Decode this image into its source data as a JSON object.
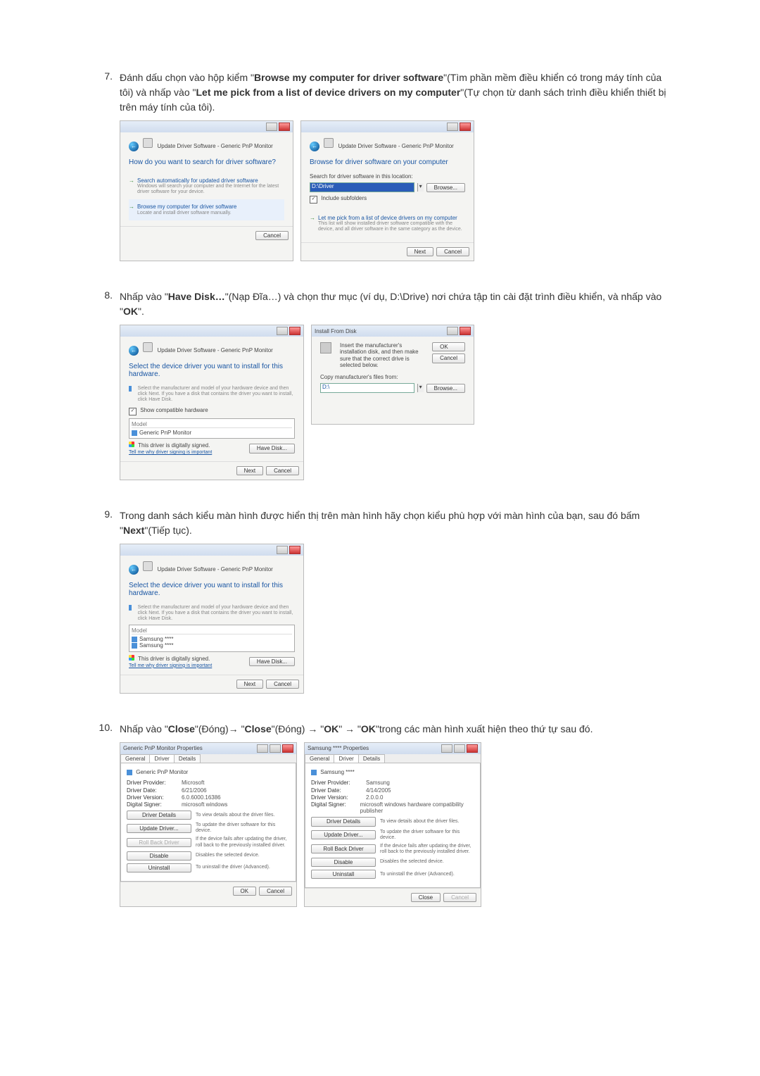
{
  "steps": {
    "s7": {
      "num": "7.",
      "text_pre": "Đánh dấu chọn vào hộp kiểm \"",
      "b1": "Browse my computer for driver software",
      "text_mid1": "\"(Tìm phần mềm điều khiển có trong máy tính của tôi) và nhấp vào \"",
      "b2": "Let me pick from a list of device drivers on my computer",
      "text_mid2": "\"(Tự chọn từ danh sách trình điều khiển thiết bị trên máy tính của tôi)."
    },
    "s8": {
      "num": "8.",
      "text_pre": "Nhấp vào \"",
      "b1": "Have Disk…",
      "text_mid1": "\"(Nạp Đĩa…) và chọn thư mục (ví dụ, D:\\Drive) nơi chứa tập tin cài đặt trình điều khiển, và nhấp vào \"",
      "b2": "OK",
      "text_end": "\"."
    },
    "s9": {
      "num": "9.",
      "text_pre": "Trong danh sách kiểu màn hình được hiển thị trên màn hình hãy chọn kiểu phù hợp với màn hình của bạn, sau đó bấm \"",
      "b1": "Next",
      "text_end": "\"(Tiếp tục)."
    },
    "s10": {
      "num": "10.",
      "text_pre": "Nhấp vào \"",
      "b1": "Close",
      "text_m1": "\"(Đóng)→ \"",
      "b2": "Close",
      "text_m2": "\"(Đóng) → \"",
      "b3": "OK",
      "text_m3": "\" → \"",
      "b4": "OK",
      "text_end": "\"trong các màn hình xuất hiện theo thứ tự sau đó."
    }
  },
  "dlg7a": {
    "title": "Update Driver Software - Generic PnP Monitor",
    "heading": "How do you want to search for driver software?",
    "opt1_title": "Search automatically for updated driver software",
    "opt1_sub": "Windows will search your computer and the Internet for the latest driver software for your device.",
    "opt2_title": "Browse my computer for driver software",
    "opt2_sub": "Locate and install driver software manually.",
    "cancel": "Cancel"
  },
  "dlg7b": {
    "title": "Update Driver Software - Generic PnP Monitor",
    "heading": "Browse for driver software on your computer",
    "search_label": "Search for driver software in this location:",
    "path": "D:\\Driver",
    "browse": "Browse...",
    "include": "Include subfolders",
    "opt_title": "Let me pick from a list of device drivers on my computer",
    "opt_sub": "This list will show installed driver software compatible with the device, and all driver software in the same category as the device.",
    "next": "Next",
    "cancel": "Cancel"
  },
  "dlg8a": {
    "title": "Update Driver Software - Generic PnP Monitor",
    "heading": "Select the device driver you want to install for this hardware.",
    "sub": "Select the manufacturer and model of your hardware device and then click Next. If you have a disk that contains the driver you want to install, click Have Disk.",
    "show_compat": "Show compatible hardware",
    "model_hdr": "Model",
    "model1": "Generic PnP Monitor",
    "signed": "This driver is digitally signed.",
    "tell_link": "Tell me why driver signing is important",
    "have_disk": "Have Disk...",
    "next": "Next",
    "cancel": "Cancel"
  },
  "dlg8b": {
    "title": "Install From Disk",
    "msg": "Insert the manufacturer's installation disk, and then make sure that the correct drive is selected below.",
    "ok": "OK",
    "cancel": "Cancel",
    "copy_label": "Copy manufacturer's files from:",
    "path": "D:\\",
    "browse": "Browse..."
  },
  "dlg9": {
    "title": "Update Driver Software - Generic PnP Monitor",
    "heading": "Select the device driver you want to install for this hardware.",
    "sub": "Select the manufacturer and model of your hardware device and then click Next. If you have a disk that contains the driver you want to install, click Have Disk.",
    "model_hdr": "Model",
    "model1": "Samsung ****",
    "model2": "Samsung ****",
    "signed": "This driver is digitally signed.",
    "tell_link": "Tell me why driver signing is important",
    "have_disk": "Have Disk...",
    "next": "Next",
    "cancel": "Cancel"
  },
  "dlg10a": {
    "title": "Generic PnP Monitor Properties",
    "tab_general": "General",
    "tab_driver": "Driver",
    "tab_details": "Details",
    "name": "Generic PnP Monitor",
    "k_provider": "Driver Provider:",
    "v_provider": "Microsoft",
    "k_date": "Driver Date:",
    "v_date": "6/21/2006",
    "k_version": "Driver Version:",
    "v_version": "6.0.6000.16386",
    "k_signer": "Digital Signer:",
    "v_signer": "microsoft windows",
    "btn_details": "Driver Details",
    "btn_details_desc": "To view details about the driver files.",
    "btn_update": "Update Driver...",
    "btn_update_desc": "To update the driver software for this device.",
    "btn_rollback": "Roll Back Driver",
    "btn_rollback_desc": "If the device fails after updating the driver, roll back to the previously installed driver.",
    "btn_disable": "Disable",
    "btn_disable_desc": "Disables the selected device.",
    "btn_uninstall": "Uninstall",
    "btn_uninstall_desc": "To uninstall the driver (Advanced).",
    "ok": "OK",
    "cancel": "Cancel"
  },
  "dlg10b": {
    "title": "Samsung **** Properties",
    "tab_general": "General",
    "tab_driver": "Driver",
    "tab_details": "Details",
    "name": "Samsung ****",
    "k_provider": "Driver Provider:",
    "v_provider": "Samsung",
    "k_date": "Driver Date:",
    "v_date": "4/14/2005",
    "k_version": "Driver Version:",
    "v_version": "2.0.0.0",
    "k_signer": "Digital Signer:",
    "v_signer": "microsoft windows hardware compatibility publisher",
    "btn_details": "Driver Details",
    "btn_details_desc": "To view details about the driver files.",
    "btn_update": "Update Driver...",
    "btn_update_desc": "To update the driver software for this device.",
    "btn_rollback": "Roll Back Driver",
    "btn_rollback_desc": "If the device fails after updating the driver, roll back to the previously installed driver.",
    "btn_disable": "Disable",
    "btn_disable_desc": "Disables the selected device.",
    "btn_uninstall": "Uninstall",
    "btn_uninstall_desc": "To uninstall the driver (Advanced).",
    "close": "Close",
    "cancel": "Cancel"
  }
}
